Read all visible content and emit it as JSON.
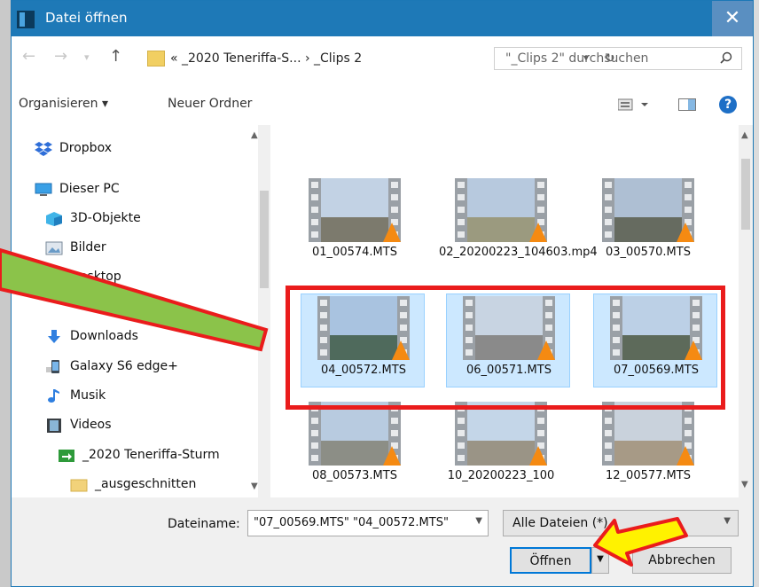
{
  "dialog": {
    "title": "Datei öffnen",
    "close_glyph": "✕",
    "accent": "#1e79b7"
  },
  "address": {
    "path": "«  _2020 Teneriffa-S...  ›  _Clips 2",
    "search_placeholder": "\"_Clips 2\" durchsuchen"
  },
  "toolbar": {
    "organize_label": "Organisieren ▾",
    "new_folder_label": "Neuer Ordner",
    "help_glyph": "?"
  },
  "nav": {
    "items": [
      {
        "label": "Dropbox",
        "icon": "dropbox-icon"
      },
      {
        "label": "Dieser PC",
        "icon": "pc-icon"
      },
      {
        "label": "3D-Objekte",
        "icon": "cube-icon"
      },
      {
        "label": "Bilder",
        "icon": "pictures-icon"
      },
      {
        "label": "Desktop",
        "icon": "desktop-icon"
      },
      {
        "label": "Downloads",
        "icon": "download-icon"
      },
      {
        "label": "Galaxy S6 edge+",
        "icon": "phone-icon"
      },
      {
        "label": "Musik",
        "icon": "music-icon"
      },
      {
        "label": "Videos",
        "icon": "videos-icon"
      },
      {
        "label": "_2020 Teneriffa-Sturm",
        "icon": "shortcut-folder-icon"
      },
      {
        "label": "_ausgeschnitten",
        "icon": "folder-icon"
      }
    ]
  },
  "files": [
    {
      "name": "01_00574.MTS",
      "selected": false
    },
    {
      "name": "02_20200223_104603.mp4",
      "selected": false
    },
    {
      "name": "03_00570.MTS",
      "selected": false
    },
    {
      "name": "04_00572.MTS",
      "selected": true
    },
    {
      "name": "06_00571.MTS",
      "selected": true
    },
    {
      "name": "07_00569.MTS",
      "selected": true
    },
    {
      "name": "08_00573.MTS",
      "selected": false
    },
    {
      "name": "10_20200223_100",
      "selected": false
    },
    {
      "name": "12_00577.MTS",
      "selected": false
    }
  ],
  "bottom": {
    "filename_label": "Dateiname:",
    "filename_value": "\"07_00569.MTS\" \"04_00572.MTS\"",
    "filter_value": "Alle Dateien (*)",
    "open_label": "Öffnen",
    "cancel_label": "Abbrechen"
  },
  "annotations": {
    "highlight_color": "#ea1c1c",
    "green_arrow_color": "#8bc34a",
    "yellow_arrow_color": "#fff200"
  }
}
